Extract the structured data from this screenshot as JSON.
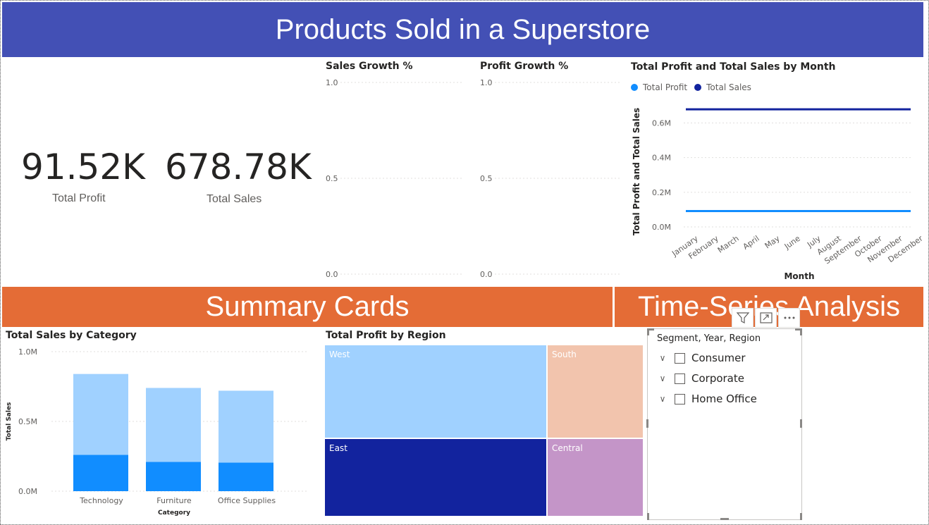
{
  "header": {
    "title": "Products Sold in a Superstore"
  },
  "kpis": [
    {
      "value": "91.52K",
      "label": "Total Profit"
    },
    {
      "value": "678.78K",
      "label": "Total Sales"
    }
  ],
  "sales_growth": {
    "title": "Sales Growth %",
    "ticks": [
      "1.0",
      "0.5",
      "0.0"
    ]
  },
  "profit_growth": {
    "title": "Profit Growth %",
    "ticks": [
      "1.0",
      "0.5",
      "0.0"
    ]
  },
  "sections": {
    "summary": "Summary Cards",
    "timeseries": "Time-Series Analysis"
  },
  "colors": {
    "header_bg": "#4350B5",
    "section_bg": "#E46C36",
    "profit": "#118DFF",
    "sales": "#12239E",
    "light_blue": "#A0D1FF",
    "west": "#A0D1FF",
    "south": "#F2C4AD",
    "east": "#12239E",
    "central": "#C495C8"
  },
  "slicer": {
    "header": "Segment, Year, Region",
    "items": [
      "Consumer",
      "Corporate",
      "Home Office"
    ],
    "icons": [
      "filter-icon",
      "focus-mode-icon",
      "more-options-icon"
    ]
  },
  "chart_data": [
    {
      "type": "line",
      "title": "Total Profit and Total Sales by Month",
      "xlabel": "Month",
      "ylabel": "Total Profit and Total Sales",
      "categories": [
        "January",
        "February",
        "March",
        "April",
        "May",
        "June",
        "July",
        "August",
        "September",
        "October",
        "November",
        "December"
      ],
      "yticks": [
        "0.0M",
        "0.2M",
        "0.4M",
        "0.6M"
      ],
      "ylim": [
        0,
        0.72
      ],
      "legend": "top-left",
      "series": [
        {
          "name": "Total Profit",
          "values": [
            0.09152,
            0.09152,
            0.09152,
            0.09152,
            0.09152,
            0.09152,
            0.09152,
            0.09152,
            0.09152,
            0.09152,
            0.09152,
            0.09152
          ]
        },
        {
          "name": "Total Sales",
          "values": [
            0.67878,
            0.67878,
            0.67878,
            0.67878,
            0.67878,
            0.67878,
            0.67878,
            0.67878,
            0.67878,
            0.67878,
            0.67878,
            0.67878
          ]
        }
      ]
    },
    {
      "type": "bar",
      "title": "Total Sales by Category",
      "xlabel": "Category",
      "ylabel": "Total Sales",
      "categories": [
        "Technology",
        "Furniture",
        "Office Supplies"
      ],
      "yticks": [
        "0.0M",
        "0.5M",
        "1.0M"
      ],
      "ylim": [
        0,
        1.0
      ],
      "series": [
        {
          "values": [
            0.26,
            0.21,
            0.205
          ]
        },
        {
          "values": [
            0.58,
            0.53,
            0.515
          ]
        }
      ]
    },
    {
      "type": "treemap",
      "title": "Total Profit by Region",
      "labels": [
        "West",
        "South",
        "East",
        "Central"
      ]
    }
  ]
}
